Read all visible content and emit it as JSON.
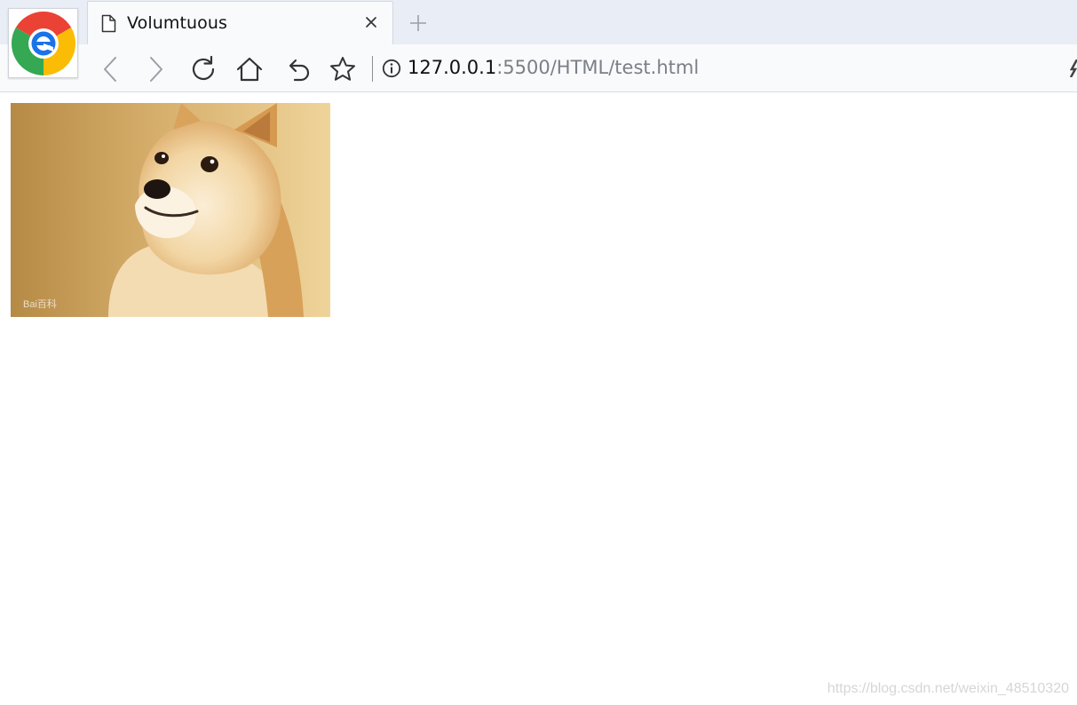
{
  "browser": {
    "logo_icon": "browser-e-logo-icon",
    "tab": {
      "title": "Volumtuous",
      "icon": "page-icon"
    },
    "address_bar": {
      "host": "127.0.0.1",
      "path": ":5500/HTML/test.html"
    },
    "toolbar_icons": [
      "back-icon",
      "forward-icon",
      "reload-icon",
      "home-icon",
      "undo-icon",
      "star-icon",
      "info-icon"
    ]
  },
  "page": {
    "image_watermark": "Bai百科",
    "footer_watermark": "https://blog.csdn.net/weixin_48510320"
  },
  "colors": {
    "tabstrip": "#e9edf5",
    "toolbar": "#f9fafc",
    "logo_red": "#ea4335",
    "logo_yellow": "#fbbc05",
    "logo_green": "#34a853",
    "logo_blue": "#1a73e8"
  }
}
